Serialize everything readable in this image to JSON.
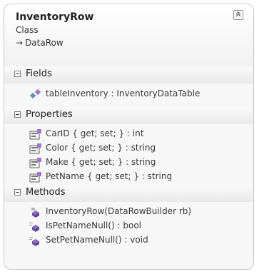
{
  "class": {
    "name": "InventoryRow",
    "kind": "Class",
    "base_arrow": "→",
    "base": "DataRow"
  },
  "sections": {
    "fields": {
      "label": "Fields",
      "items": [
        "tableInventory : InventoryDataTable"
      ]
    },
    "properties": {
      "label": "Properties",
      "items": [
        "CarID { get; set; } : int",
        "Color { get; set; } : string",
        "Make { get; set; } : string",
        "PetName { get; set; } : string"
      ]
    },
    "methods": {
      "label": "Methods",
      "items": [
        "InventoryRow(DataRowBuilder rb)",
        "IsPetNameNull() : bool",
        "SetPetNameNull() : void"
      ]
    }
  },
  "icons": {
    "field": "field-icon",
    "property": "property-icon",
    "method": "method-icon",
    "collapse": "collapse-chevron-icon"
  }
}
